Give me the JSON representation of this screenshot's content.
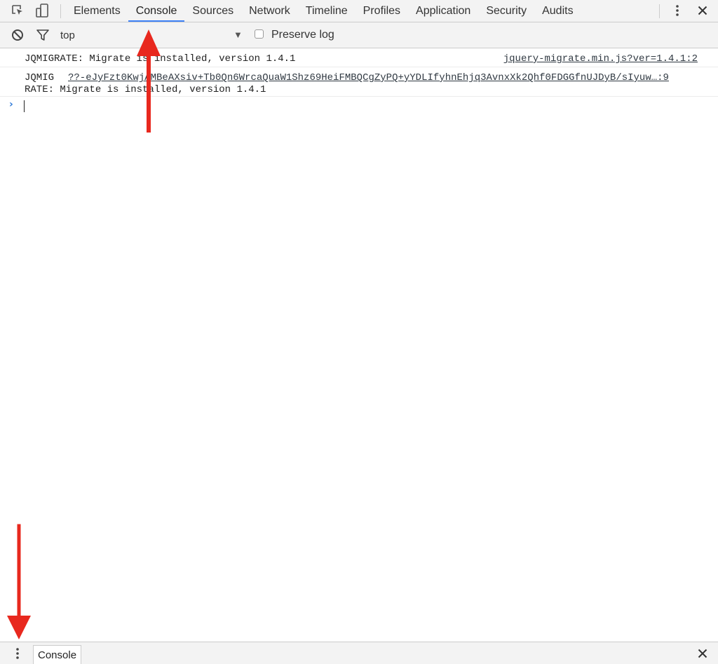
{
  "tabs": [
    {
      "label": "Elements",
      "active": false
    },
    {
      "label": "Console",
      "active": true
    },
    {
      "label": "Sources",
      "active": false
    },
    {
      "label": "Network",
      "active": false
    },
    {
      "label": "Timeline",
      "active": false
    },
    {
      "label": "Profiles",
      "active": false
    },
    {
      "label": "Application",
      "active": false
    },
    {
      "label": "Security",
      "active": false
    },
    {
      "label": "Audits",
      "active": false
    }
  ],
  "toolbar": {
    "context": "top",
    "preserve_log_label": "Preserve log",
    "preserve_log_checked": false
  },
  "messages": [
    {
      "text": "JQMIGRATE: Migrate is installed, version 1.4.1",
      "source": "jquery-migrate.min.js?ver=1.4.1:2"
    },
    {
      "head": "JQMIG",
      "link": "??-eJyFzt0KwjAMBeAXsiv+Tb0Qn6WrcaQuaW1Shz69HeiFMBQCgZyPQ+yYDLIfyhnEhjq3AvnxXk2Qhf0FDGGfnUJDyB/sIyuw…:9",
      "tail": "RATE: Migrate is installed, version 1.4.1"
    }
  ],
  "drawer": {
    "tab_label": "Console"
  },
  "icons": {
    "inspect": "inspect-element-icon",
    "device": "device-mode-icon",
    "more": "more-vertical-icon",
    "close": "close-icon",
    "clear": "clear-console-icon",
    "filter": "filter-icon"
  },
  "colors": {
    "active_tab_underline": "#3e82f7",
    "prompt_chevron": "#2f7ad8",
    "annotation_arrow": "#e8281e"
  }
}
